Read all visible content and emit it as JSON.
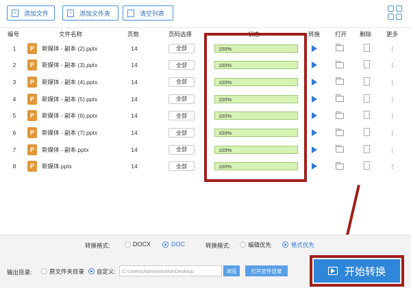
{
  "toolbar": {
    "add_file": "添加文件",
    "add_folder": "添加文件夹",
    "clear_list": "清空列表"
  },
  "columns": {
    "index": "编号",
    "name": "文件名称",
    "pages": "页数",
    "page_select": "页码选择",
    "status": "状态",
    "convert": "转换",
    "open": "打开",
    "delete": "删除",
    "more": "更多"
  },
  "rows": [
    {
      "index": "1",
      "name": "新媒体 - 副本 (2).pptx",
      "pages": "14",
      "page_select": "全部",
      "progress": "100%"
    },
    {
      "index": "2",
      "name": "新媒体 - 副本 (3).pptx",
      "pages": "14",
      "page_select": "全部",
      "progress": "100%"
    },
    {
      "index": "3",
      "name": "新媒体 - 副本 (4).pptx",
      "pages": "14",
      "page_select": "全部",
      "progress": "100%"
    },
    {
      "index": "4",
      "name": "新媒体 - 副本 (5).pptx",
      "pages": "14",
      "page_select": "全部",
      "progress": "100%"
    },
    {
      "index": "5",
      "name": "新媒体 - 副本 (6).pptx",
      "pages": "14",
      "page_select": "全部",
      "progress": "100%"
    },
    {
      "index": "6",
      "name": "新媒体 - 副本 (7).pptx",
      "pages": "14",
      "page_select": "全部",
      "progress": "100%"
    },
    {
      "index": "7",
      "name": "新媒体 - 副本.pptx",
      "pages": "14",
      "page_select": "全部",
      "progress": "100%"
    },
    {
      "index": "8",
      "name": "新媒体.pptx",
      "pages": "14",
      "page_select": "全部",
      "progress": "100%"
    }
  ],
  "file_icon_letter": "P",
  "format": {
    "label": "转换格式:",
    "options": [
      "DOCX",
      "DOC"
    ],
    "selected": "DOC"
  },
  "mode": {
    "label": "转换模式:",
    "options": [
      "编辑优先",
      "格式优先"
    ],
    "selected": "格式优先"
  },
  "output": {
    "label": "输出目录:",
    "source_option": "原文件夹目录",
    "custom_option": "自定义:",
    "path": "C:\\Users\\Administrator\\Desktop",
    "browse": "浏览",
    "open_folder": "打开文件目录"
  },
  "start_button": "开始转换",
  "colors": {
    "accent": "#2f86d8",
    "highlight_red": "#a01f1b",
    "progress_fill": "#e1f7c9",
    "file_icon": "#e0973a"
  }
}
